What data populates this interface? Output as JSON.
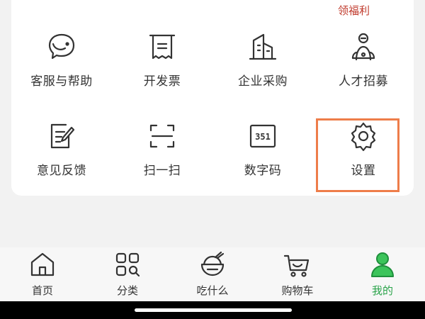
{
  "promo_label": "领福利",
  "grid": {
    "row1": [
      {
        "label": "客服与帮助",
        "icon": "customer-service-icon"
      },
      {
        "label": "开发票",
        "icon": "invoice-icon"
      },
      {
        "label": "企业采购",
        "icon": "enterprise-building-icon"
      },
      {
        "label": "人才招募",
        "icon": "recruit-person-icon"
      }
    ],
    "row2": [
      {
        "label": "意见反馈",
        "icon": "feedback-icon"
      },
      {
        "label": "扫一扫",
        "icon": "scan-icon"
      },
      {
        "label": "数字码",
        "icon": "digit-code-icon",
        "code_text": "351"
      },
      {
        "label": "设置",
        "icon": "gear-icon"
      }
    ]
  },
  "highlight_color": "#ee7d4a",
  "tabbar": {
    "active_color": "#2aa34a",
    "tabs": [
      {
        "label": "首页",
        "icon": "home-icon"
      },
      {
        "label": "分类",
        "icon": "category-icon"
      },
      {
        "label": "吃什么",
        "icon": "rice-bowl-icon"
      },
      {
        "label": "购物车",
        "icon": "cart-icon"
      },
      {
        "label": "我的",
        "icon": "profile-icon",
        "active": true
      }
    ]
  }
}
